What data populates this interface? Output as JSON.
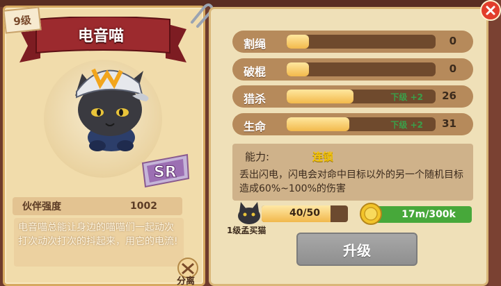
{
  "hero": {
    "level": "9级",
    "name": "电音喵",
    "rarity": "SR",
    "strength_label": "伙伴强度",
    "strength_value": "1002",
    "description": "电音喵总能让身边的喵喵们一起动次打次动次打次的抖起来，用它的电流!",
    "detach_label": "分离"
  },
  "stats": [
    {
      "label": "割绳",
      "value": "0",
      "fill": 0.15,
      "bonus": ""
    },
    {
      "label": "破棍",
      "value": "0",
      "fill": 0.15,
      "bonus": ""
    },
    {
      "label": "猎杀",
      "value": "26",
      "fill": 0.45,
      "bonus": "下级 +2"
    },
    {
      "label": "生命",
      "value": "31",
      "fill": 0.42,
      "bonus": "下级 +2"
    }
  ],
  "ability": {
    "label": "能力:",
    "name": "连锁",
    "description": "丢出闪电，闪电会对命中目标以外的另一个随机目标造成60%~100%的伤害"
  },
  "upgrade": {
    "xp_text": "40/50",
    "xp_fill": 0.8,
    "xp_caption": "1级孟买猫",
    "gold_text": "17m/300k",
    "button_label": "升级"
  },
  "colors": {
    "accent_gold": "#f5c400",
    "bonus_green": "#3aa04a",
    "close_red": "#e23d2b"
  },
  "icons": {
    "close": "close-icon",
    "coin": "coin-icon",
    "paperclip": "paperclip-icon",
    "detach": "detach-icon"
  }
}
